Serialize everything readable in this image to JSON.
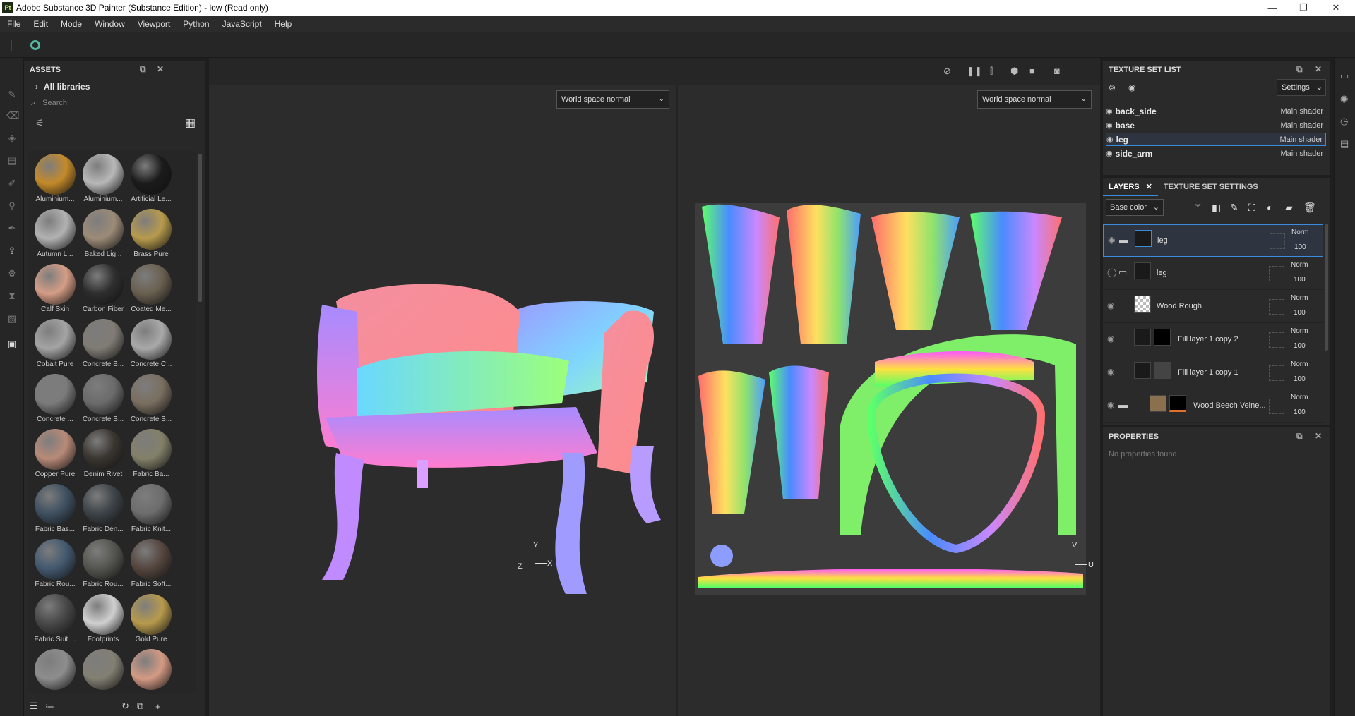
{
  "window": {
    "title": "Adobe Substance 3D Painter (Substance Edition) - low (Read only)",
    "app_icon": "Pt",
    "min": "—",
    "max": "❐",
    "close": "✕"
  },
  "menu": [
    "File",
    "Edit",
    "Mode",
    "Window",
    "Viewport",
    "Python",
    "JavaScript",
    "Help"
  ],
  "assets": {
    "title": "ASSETS",
    "library": "All libraries",
    "search_placeholder": "Search",
    "items": [
      {
        "label": "Aluminium...",
        "color": "#c48a2a"
      },
      {
        "label": "Aluminium...",
        "color": "#b8b8b8"
      },
      {
        "label": "Artificial Le...",
        "color": "#1b1b1b"
      },
      {
        "label": "Autumn L...",
        "color": "#b2b2b2"
      },
      {
        "label": "Baked Lig...",
        "color": "#9c8b78"
      },
      {
        "label": "Brass Pure",
        "color": "#b79a4c"
      },
      {
        "label": "Calf Skin",
        "color": "#d59d86"
      },
      {
        "label": "Carbon Fiber",
        "color": "#2e2e2e"
      },
      {
        "label": "Coated Me...",
        "color": "#6a6050"
      },
      {
        "label": "Cobalt Pure",
        "color": "#a4a4a4"
      },
      {
        "label": "Concrete B...",
        "color": "#807b74"
      },
      {
        "label": "Concrete C...",
        "color": "#a9a9a9"
      },
      {
        "label": "Concrete ...",
        "color": "#7b7b7b"
      },
      {
        "label": "Concrete S...",
        "color": "#6b6b6b"
      },
      {
        "label": "Concrete S...",
        "color": "#7a6f60"
      },
      {
        "label": "Copper Pure",
        "color": "#b88a78"
      },
      {
        "label": "Denim Rivet",
        "color": "#3a3530"
      },
      {
        "label": "Fabric Ba...",
        "color": "#838069"
      },
      {
        "label": "Fabric Bas...",
        "color": "#3e5060"
      },
      {
        "label": "Fabric Den...",
        "color": "#3d4348"
      },
      {
        "label": "Fabric Knit...",
        "color": "#6d6d6d"
      },
      {
        "label": "Fabric Rou...",
        "color": "#43596f"
      },
      {
        "label": "Fabric Rou...",
        "color": "#555550"
      },
      {
        "label": "Fabric Soft...",
        "color": "#55463e"
      },
      {
        "label": "Fabric Suit ...",
        "color": "#484848"
      },
      {
        "label": "Footprints",
        "color": "#d0d0d0"
      },
      {
        "label": "Gold Pure",
        "color": "#b79a4c"
      },
      {
        "label": "",
        "color": "#8d8d8d"
      },
      {
        "label": "",
        "color": "#827f73"
      },
      {
        "label": "",
        "color": "#d49a84"
      }
    ]
  },
  "viewport": {
    "left_mode": "World space normal",
    "right_mode": "World space normal",
    "axis_y": "Y",
    "axis_x": "X",
    "axis_z": "Z",
    "uv_v": "V",
    "uv_u": "U"
  },
  "texture_set_list": {
    "title": "TEXTURE SET LIST",
    "settings": "Settings",
    "rows": [
      {
        "name": "back_side",
        "shader": "Main shader"
      },
      {
        "name": "base",
        "shader": "Main shader"
      },
      {
        "name": "leg",
        "shader": "Main shader"
      },
      {
        "name": "side_arm",
        "shader": "Main shader"
      }
    ]
  },
  "layers": {
    "tab1": "LAYERS",
    "tab2": "TEXTURE SET SETTINGS",
    "channel": "Base color",
    "rows": [
      {
        "name": "leg",
        "blend": "Norm",
        "opacity": "100"
      },
      {
        "name": "leg",
        "blend": "Norm",
        "opacity": "100"
      },
      {
        "name": "Wood Rough",
        "blend": "Norm",
        "opacity": "100"
      },
      {
        "name": "Fill layer 1 copy 2",
        "blend": "Norm",
        "opacity": "100"
      },
      {
        "name": "Fill layer 1 copy 1",
        "blend": "Norm",
        "opacity": "100"
      },
      {
        "name": "Wood Beech Veine...",
        "blend": "Norm",
        "opacity": "100"
      }
    ]
  },
  "properties": {
    "title": "PROPERTIES",
    "empty": "No properties found"
  }
}
